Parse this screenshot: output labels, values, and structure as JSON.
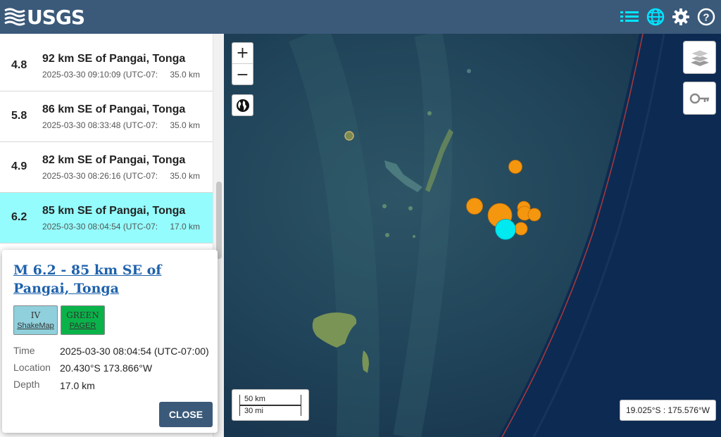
{
  "header": {
    "logo_text": "USGS",
    "icons": [
      "list-icon",
      "globe-icon",
      "gear-icon",
      "help-icon"
    ],
    "accent_color": "#00e5ff",
    "bg_color": "#3b5a7a"
  },
  "earthquakes": [
    {
      "mag": "4.8",
      "title": "92 km SE of Pangai, Tonga",
      "time": "2025-03-30 09:10:09 (UTC-07:",
      "depth": "35.0 km",
      "selected": false
    },
    {
      "mag": "5.8",
      "title": "86 km SE of Pangai, Tonga",
      "time": "2025-03-30 08:33:48 (UTC-07:",
      "depth": "35.0 km",
      "selected": false
    },
    {
      "mag": "4.9",
      "title": "82 km SE of Pangai, Tonga",
      "time": "2025-03-30 08:26:16 (UTC-07:",
      "depth": "35.0 km",
      "selected": false
    },
    {
      "mag": "6.2",
      "title": "85 km SE of Pangai, Tonga",
      "time": "2025-03-30 08:04:54 (UTC-07:",
      "depth": "17.0 km",
      "selected": true
    }
  ],
  "popup": {
    "title": "M 6.2 - 85 km SE of Pangai, Tonga",
    "shakemap": {
      "value": "IV",
      "label": "ShakeMap",
      "color": "#8fd0dc"
    },
    "pager": {
      "value": "GREEN",
      "label": "PAGER",
      "color": "#0ab34a"
    },
    "time_label": "Time",
    "time_value": "2025-03-30 08:04:54 (UTC-07:00)",
    "location_label": "Location",
    "location_value": "20.430°S 173.866°W",
    "depth_label": "Depth",
    "depth_value": "17.0 km",
    "close_label": "CLOSE"
  },
  "map": {
    "zoom_in": "+",
    "zoom_out": "−",
    "scale_km": "50 km",
    "scale_mi": "30 mi",
    "coordinates": "19.025°S : 175.576°W",
    "event_color": "#f5960f",
    "selected_event_color": "#00e8f0"
  }
}
